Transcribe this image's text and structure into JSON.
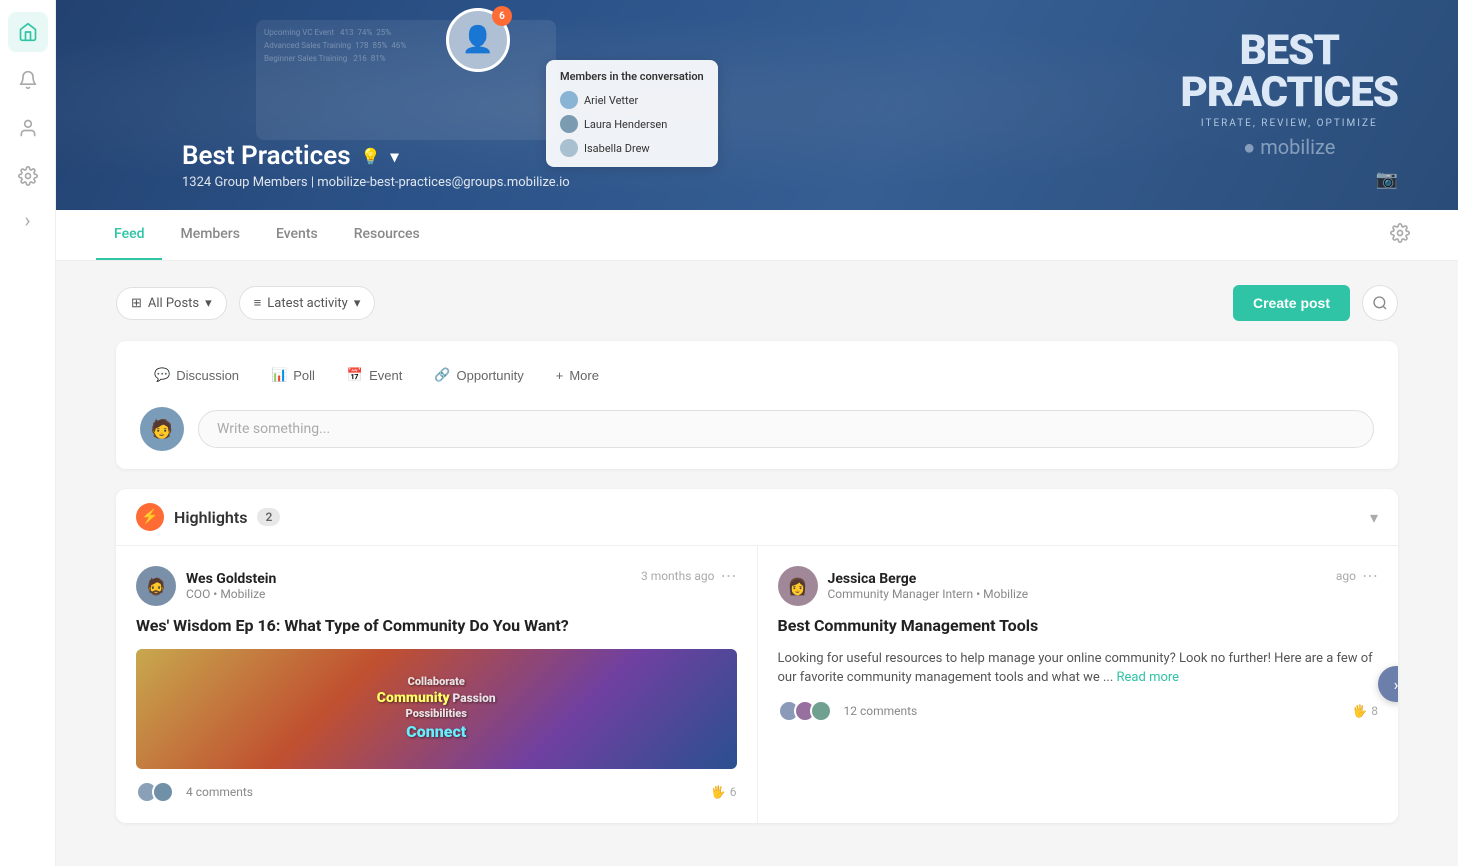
{
  "sidebar": {
    "items": [
      {
        "id": "home",
        "icon": "🏠",
        "active": true
      },
      {
        "id": "notifications",
        "icon": "📣",
        "active": false
      },
      {
        "id": "members",
        "icon": "👤",
        "active": false
      },
      {
        "id": "settings",
        "icon": "⚙️",
        "active": false
      }
    ]
  },
  "banner": {
    "group_name": "Best Practices",
    "member_count": "1324 Group Members",
    "email": "mobilize-best-practices@groups.mobilize.io",
    "subtitle": "1324 Group Members | mobilize-best-practices@groups.mobilize.io",
    "notification_count": "6",
    "logo_line1": "BEST",
    "logo_line2": "PRACTICES",
    "logo_tagline": "ITERATE, REVIEW, OPTIMIZE"
  },
  "nav": {
    "tabs": [
      {
        "label": "Feed",
        "active": true
      },
      {
        "label": "Members",
        "active": false
      },
      {
        "label": "Events",
        "active": false
      },
      {
        "label": "Resources",
        "active": false
      }
    ]
  },
  "filter": {
    "all_posts_label": "All Posts",
    "latest_activity_label": "Latest activity",
    "create_post_label": "Create post"
  },
  "post_composer": {
    "placeholder": "Write something...",
    "types": [
      {
        "id": "discussion",
        "icon": "💬",
        "label": "Discussion"
      },
      {
        "id": "poll",
        "icon": "📊",
        "label": "Poll"
      },
      {
        "id": "event",
        "icon": "📅",
        "label": "Event"
      },
      {
        "id": "opportunity",
        "icon": "🔗",
        "label": "Opportunity"
      },
      {
        "id": "more",
        "icon": "+",
        "label": "More"
      }
    ]
  },
  "highlights": {
    "title": "Highlights",
    "count": "2",
    "cards": [
      {
        "id": "card1",
        "author_name": "Wes Goldstein",
        "author_role": "COO • Mobilize",
        "time_ago": "3 months ago",
        "title": "Wes' Wisdom Ep 16: What Type of Community Do You Want?",
        "image_text": "Collaborate\nCommunity Passion\nPossibilities\nConnect",
        "comment_count": "4 comments",
        "like_count": "6"
      },
      {
        "id": "card2",
        "author_name": "Jessica Berge",
        "author_role": "Community Manager Intern • Mobilize",
        "time_ago": "ago",
        "title": "Best Community Management Tools",
        "body": "Looking for useful resources to help manage your online community? Look no further! Here are a few of our favorite community management tools and what we ...",
        "read_more": "Read more",
        "comment_count": "12 comments",
        "like_count": "8"
      }
    ]
  }
}
